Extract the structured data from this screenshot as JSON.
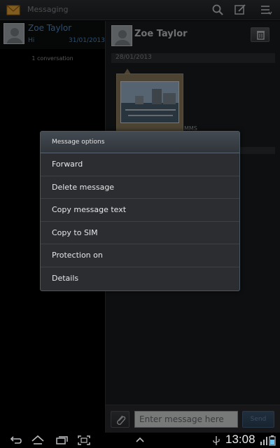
{
  "app": {
    "title": "Messaging"
  },
  "toolbar": {
    "search_icon": "search-icon",
    "compose_icon": "compose-icon",
    "menu_icon": "menu-icon"
  },
  "conversation_list": {
    "items": [
      {
        "name": "Zoe Taylor",
        "snippet": "Hi",
        "date": "31/01/2013"
      }
    ],
    "count_label": "1 conversation"
  },
  "thread": {
    "contact_name": "Zoe Taylor",
    "date_header": "28/01/2013",
    "message_type": "MMS"
  },
  "composer": {
    "placeholder": "Enter message here",
    "send_label": "Send"
  },
  "dialog": {
    "title": "Message options",
    "options": [
      "Forward",
      "Delete message",
      "Copy message text",
      "Copy to SIM",
      "Protection on",
      "Details"
    ]
  },
  "status_bar": {
    "time": "13:08"
  },
  "colors": {
    "accent_blue": "#4f8fd2",
    "bubble": "#8a7b5c",
    "dialog_border": "#4b5663"
  }
}
